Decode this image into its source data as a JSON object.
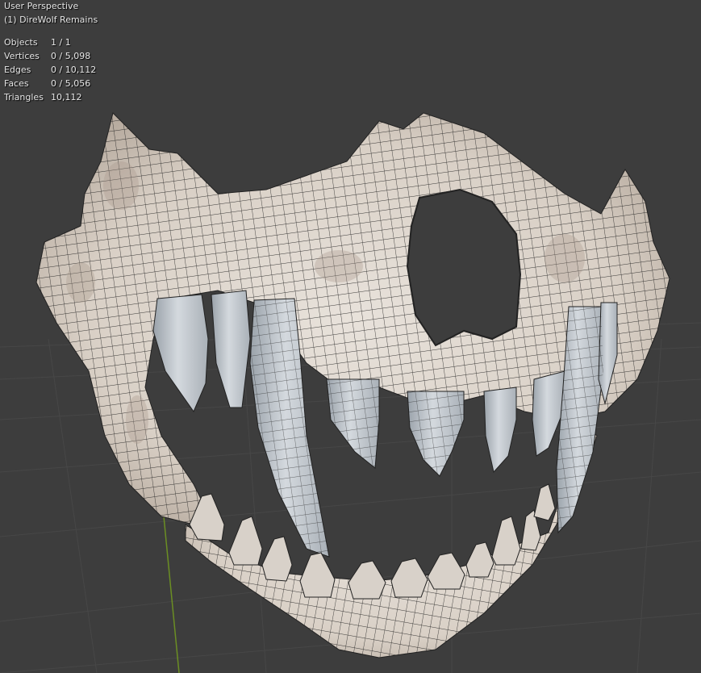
{
  "viewport": {
    "view_name": "User Perspective",
    "active_object": "(1) DireWolf Remains",
    "background": "#3d3d3d",
    "grid_color": "#4a4a4a",
    "y_axis_color": "#6b8e23",
    "model_color": "#e2dbd4",
    "teeth_color": "#c6ccd2",
    "wire_color": "#1a1a1a"
  },
  "stats": [
    {
      "label": "Objects",
      "value": "1 / 1"
    },
    {
      "label": "Vertices",
      "value": "0 / 5,098"
    },
    {
      "label": "Edges",
      "value": "0 / 10,112"
    },
    {
      "label": "Faces",
      "value": "0 / 5,056"
    },
    {
      "label": "Triangles",
      "value": "10,112"
    }
  ]
}
